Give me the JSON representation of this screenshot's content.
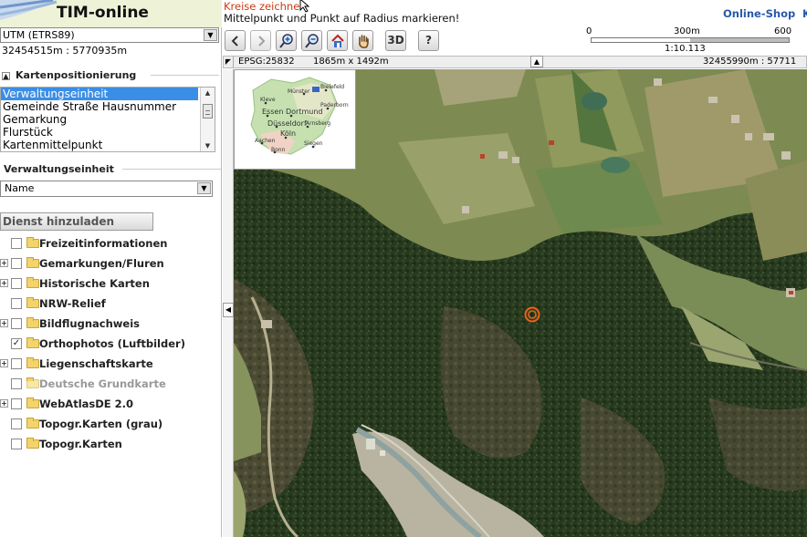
{
  "app": {
    "title": "TIM-online"
  },
  "sidebar": {
    "crs": "UTM (ETRS89)",
    "coordinate": "32454515m : 5770935m",
    "positioning": {
      "title": "Kartenpositionierung",
      "items": [
        {
          "label": "Verwaltungseinheit"
        },
        {
          "label": "Gemeinde Straße Hausnummer"
        },
        {
          "label": "Gemarkung"
        },
        {
          "label": "Flurstück"
        },
        {
          "label": "Kartenmittelpunkt"
        }
      ],
      "selected": "Verwaltungseinheit"
    },
    "admin_unit": {
      "title": "Verwaltungseinheit",
      "select_value": "Name"
    },
    "add_service_label": "Dienst hinzuladen",
    "layers": [
      {
        "label": "Freizeitinformationen",
        "expandable": false,
        "checked": false,
        "disabled": false
      },
      {
        "label": "Gemarkungen/Fluren",
        "expandable": true,
        "checked": false,
        "disabled": false
      },
      {
        "label": "Historische Karten",
        "expandable": true,
        "checked": false,
        "disabled": false
      },
      {
        "label": "NRW-Relief",
        "expandable": false,
        "checked": false,
        "disabled": false
      },
      {
        "label": "Bildflugnachweis",
        "expandable": true,
        "checked": false,
        "disabled": false
      },
      {
        "label": "Orthophotos (Luftbilder)",
        "expandable": false,
        "checked": true,
        "disabled": false
      },
      {
        "label": "Liegenschaftskarte",
        "expandable": true,
        "checked": false,
        "disabled": false
      },
      {
        "label": "Deutsche Grundkarte",
        "expandable": false,
        "checked": false,
        "disabled": true
      },
      {
        "label": "WebAtlasDE 2.0",
        "expandable": true,
        "checked": false,
        "disabled": false
      },
      {
        "label": "Topogr.Karten (grau)",
        "expandable": false,
        "checked": false,
        "disabled": false
      },
      {
        "label": "Topogr.Karten",
        "expandable": false,
        "checked": false,
        "disabled": false
      }
    ]
  },
  "topbar": {
    "hint_title": "Kreise zeichne",
    "hint_text": "Mittelpunkt und Punkt auf Radius markieren!",
    "shop_link": "Online-Shop",
    "more_link": "K"
  },
  "toolbar": {
    "buttons": [
      {
        "name": "back-button",
        "icon": "arrow-left-icon"
      },
      {
        "name": "forward-button",
        "icon": "arrow-right-icon"
      },
      {
        "name": "zoom-in-button",
        "icon": "zoom-in-icon"
      },
      {
        "name": "zoom-out-button",
        "icon": "zoom-out-icon"
      },
      {
        "name": "home-button",
        "icon": "home-icon"
      },
      {
        "name": "pan-button",
        "icon": "hand-icon"
      },
      {
        "name": "3d-button",
        "label": "3D"
      },
      {
        "name": "help-button",
        "label": "?"
      }
    ],
    "scale": {
      "label_0": "0",
      "label_mid": "300m",
      "label_max": "600",
      "ratio": "1:10.113"
    }
  },
  "infobar": {
    "epsg": "EPSG:25832",
    "extent": "1865m x 1492m",
    "coords": "32455990m : 57711"
  },
  "overview_map": {
    "cities": [
      "Kleve",
      "Münster",
      "Bielefeld",
      "Essen",
      "Dortmund",
      "Düsseldorf",
      "Arnsberg",
      "Aachen",
      "Köln",
      "Siegen",
      "Bonn",
      "Paderborn"
    ]
  },
  "colors": {
    "accent": "#2a5aa8",
    "hint": "#cc3a12",
    "selection": "#3a8ee6",
    "marker": "#e8641a"
  }
}
